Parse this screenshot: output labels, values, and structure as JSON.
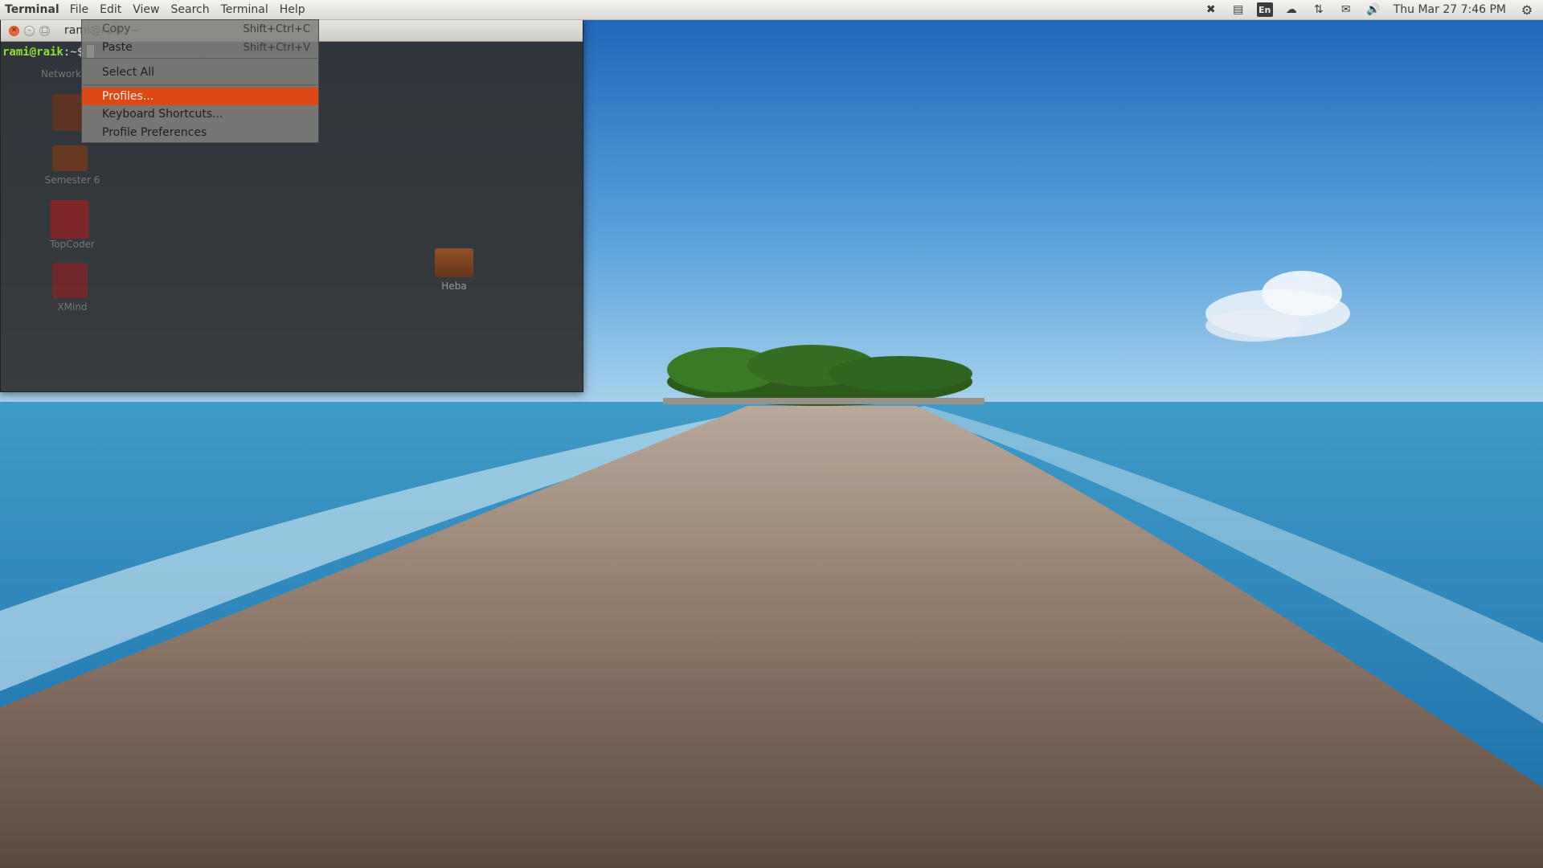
{
  "panel": {
    "app_name": "Terminal",
    "menus": [
      "File",
      "Edit",
      "View",
      "Search",
      "Terminal",
      "Help"
    ],
    "indicators": {
      "en": "En",
      "clock": "Thu Mar 27  7:46 PM"
    }
  },
  "desktop": {
    "icons": [
      "Network",
      "Semester 6",
      "TopCoder",
      "XMind",
      "Heba"
    ]
  },
  "terminal": {
    "title": "rami@raik: ~",
    "prompt_user": "rami@raik",
    "prompt_path": ":~$"
  },
  "menu": {
    "items": [
      {
        "label": "Copy",
        "shortcut": "Shift+Ctrl+C",
        "state": "dim"
      },
      {
        "label": "Paste",
        "shortcut": "Shift+Ctrl+V",
        "state": "normal"
      },
      {
        "label": "Select All",
        "shortcut": "",
        "state": "normal"
      },
      {
        "label": "Profiles...",
        "shortcut": "",
        "state": "highlighted"
      },
      {
        "label": "Keyboard Shortcuts...",
        "shortcut": "",
        "state": "normal"
      },
      {
        "label": "Profile Preferences",
        "shortcut": "",
        "state": "normal"
      }
    ]
  },
  "colors": {
    "accent": "#dd4814",
    "prompt": "#8ae234"
  }
}
